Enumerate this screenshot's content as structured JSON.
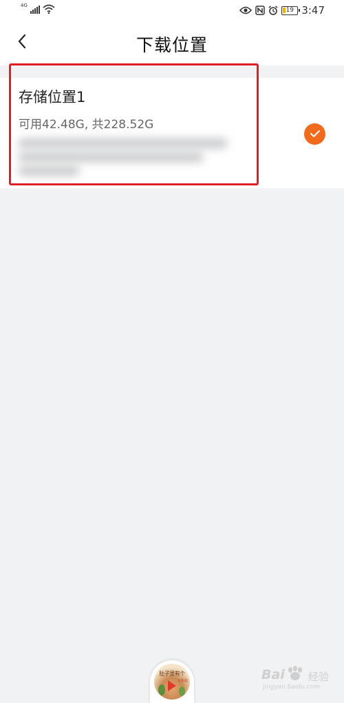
{
  "status_bar": {
    "network_label": "4G",
    "battery_level": "19",
    "time": "3:47",
    "icons": [
      "signal-icon",
      "wifi-icon",
      "eye-comfort-icon",
      "nfc-icon",
      "alarm-icon",
      "battery-icon"
    ]
  },
  "header": {
    "back_icon": "chevron-left-icon",
    "title": "下载位置"
  },
  "storage_option": {
    "name": "存储位置1",
    "capacity": "可用42.48G, 共228.52G",
    "selected": true,
    "check_icon": "check-icon"
  },
  "mini_player": {
    "cover_text": "肚子里有个",
    "cover_tag": "火车站",
    "play_icon": "play-icon"
  },
  "watermark": {
    "brand": "Bai",
    "brand_cn": "经验",
    "url": "jingyan.baidu.com"
  },
  "colors": {
    "accent": "#f26a1b",
    "highlight_border": "#e01e2b",
    "page_background": "#f1f2f4"
  }
}
